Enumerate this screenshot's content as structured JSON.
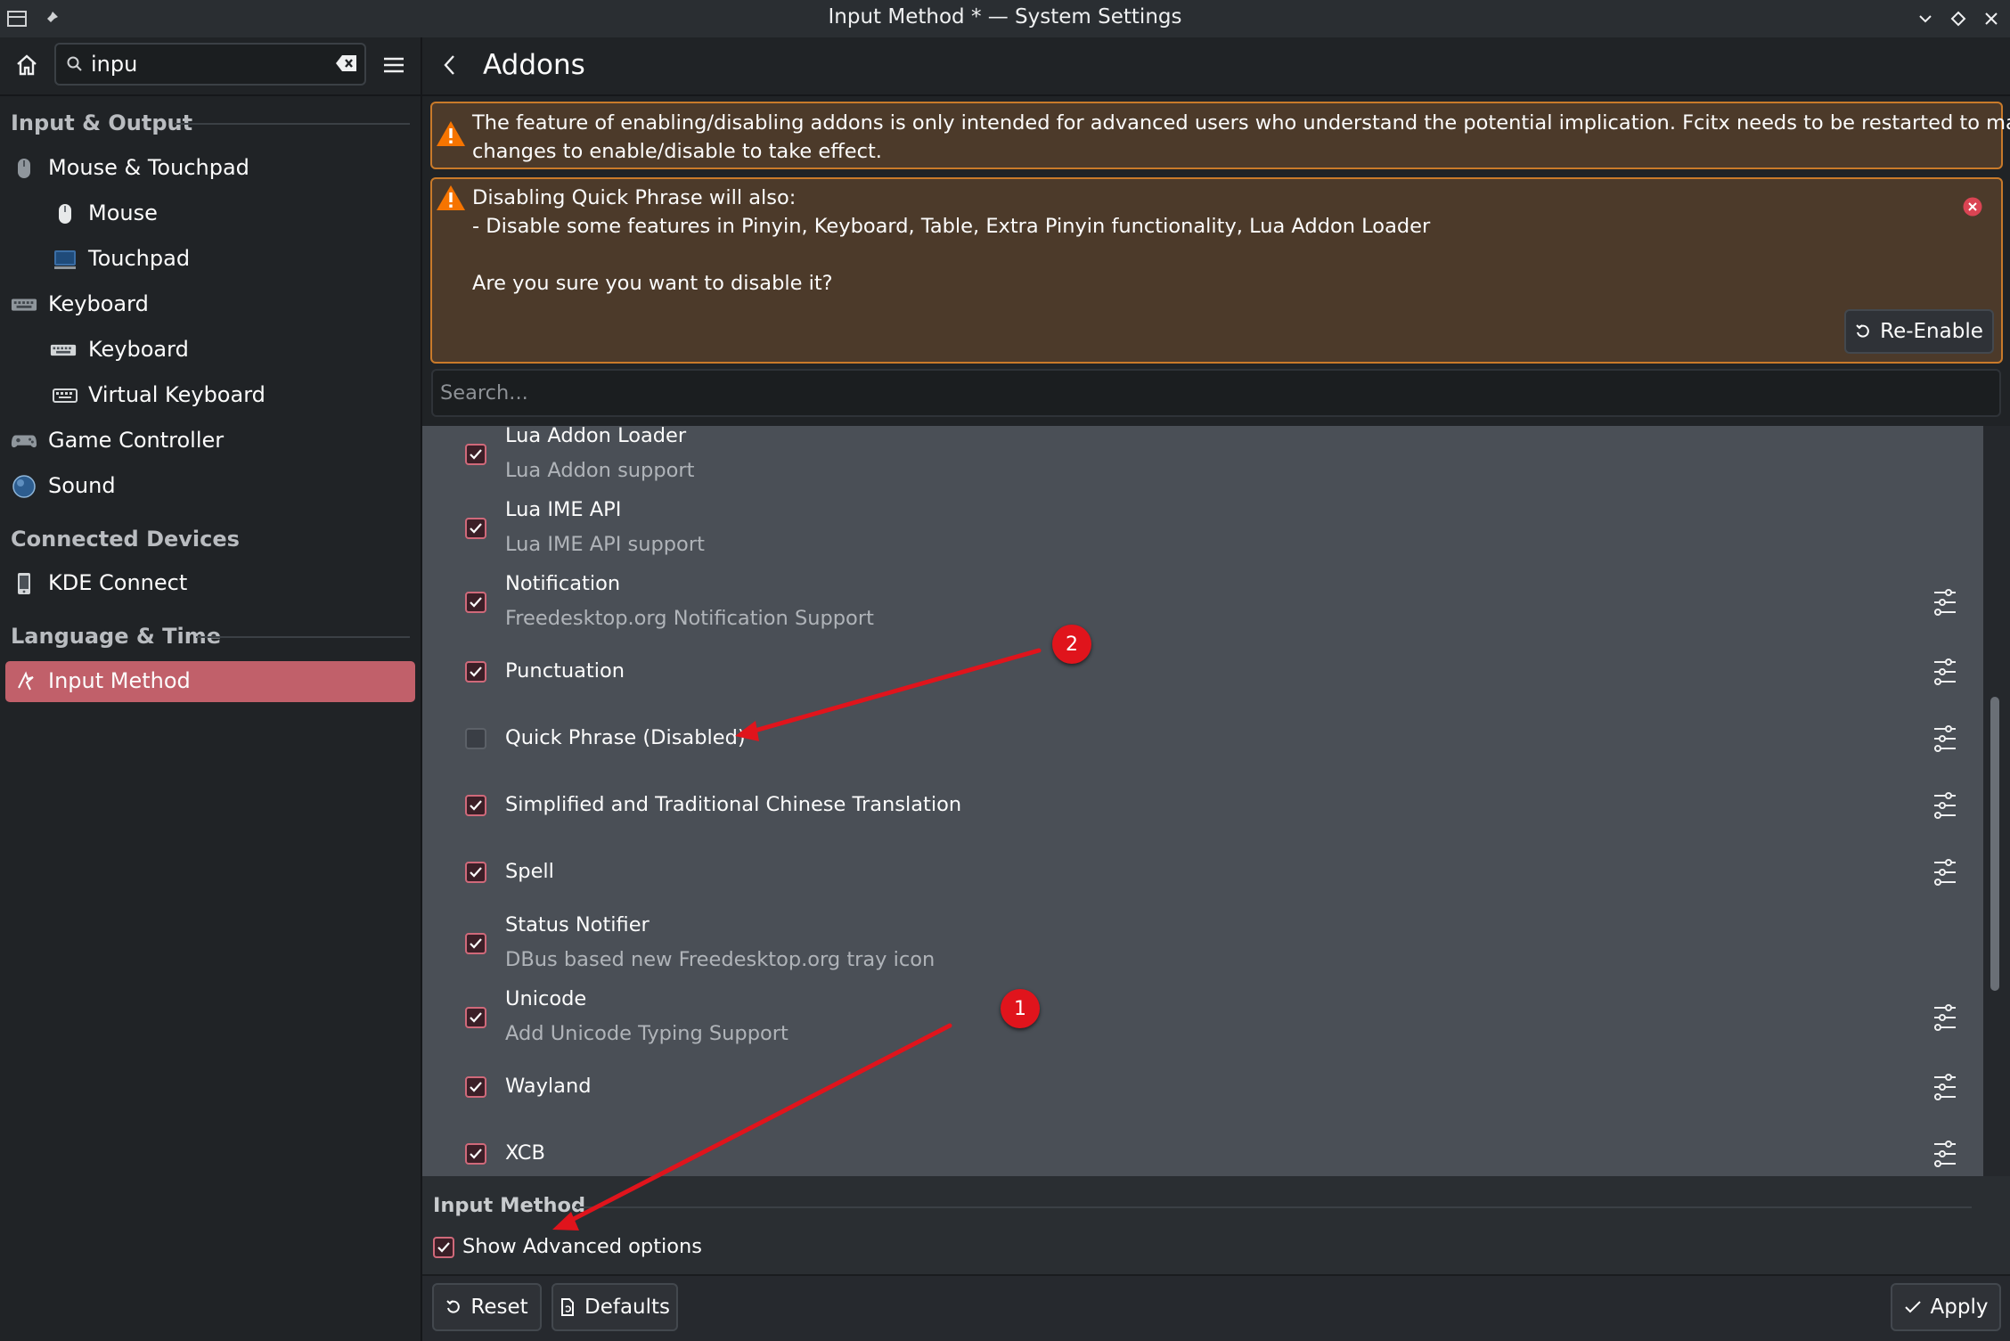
{
  "window": {
    "title": "Input Method * — System Settings"
  },
  "sidebar": {
    "search_value": "inpu",
    "categories": [
      {
        "title": "Input & Output",
        "items": [
          {
            "label": "Mouse & Touchpad",
            "icon": "mouse-icon"
          },
          {
            "label": "Mouse",
            "icon": "mouse-icon",
            "sub": true
          },
          {
            "label": "Touchpad",
            "icon": "touchpad-icon",
            "sub": true
          },
          {
            "label": "Keyboard",
            "icon": "keyboard-icon"
          },
          {
            "label": "Keyboard",
            "icon": "keyboard-icon",
            "sub": true
          },
          {
            "label": "Virtual Keyboard",
            "icon": "virtual-keyboard-icon",
            "sub": true
          },
          {
            "label": "Game Controller",
            "icon": "gamepad-icon"
          },
          {
            "label": "Sound",
            "icon": "sound-icon"
          }
        ]
      },
      {
        "title": "Connected Devices",
        "items": [
          {
            "label": "KDE Connect",
            "icon": "phone-icon"
          }
        ]
      },
      {
        "title": "Language & Time",
        "items": [
          {
            "label": "Input Method",
            "icon": "input-method-icon",
            "selected": true
          }
        ]
      }
    ],
    "selected_color": "#c1606a"
  },
  "page": {
    "title": "Addons"
  },
  "warning1": {
    "line1": "The feature of enabling/disabling addons is only intended for advanced users who understand the potential implication. Fcitx needs to be restarted to make the",
    "line2": "changes to enable/disable to take effect."
  },
  "warning2": {
    "line1": "Disabling Quick Phrase will also:",
    "line2": "- Disable some features in Pinyin, Keyboard, Table, Extra Pinyin functionality, Lua Addon Loader",
    "line3": "Are you sure you want to disable it?",
    "button": "Re-Enable"
  },
  "search": {
    "placeholder": "Search..."
  },
  "addons": [
    {
      "title": "Lua Addon Loader",
      "subtitle": "Lua Addon support",
      "checked": true,
      "configurable": false
    },
    {
      "title": "Lua IME API",
      "subtitle": "Lua IME API support",
      "checked": true,
      "configurable": false
    },
    {
      "title": "Notification",
      "subtitle": "Freedesktop.org Notification Support",
      "checked": true,
      "configurable": true
    },
    {
      "title": "Punctuation",
      "subtitle": "",
      "checked": true,
      "configurable": true
    },
    {
      "title": "Quick Phrase (Disabled)",
      "subtitle": "",
      "checked": false,
      "configurable": true
    },
    {
      "title": "Simplified and Traditional Chinese Translation",
      "subtitle": "",
      "checked": true,
      "configurable": true
    },
    {
      "title": "Spell",
      "subtitle": "",
      "checked": true,
      "configurable": true
    },
    {
      "title": "Status Notifier",
      "subtitle": "DBus based new Freedesktop.org tray icon",
      "checked": true,
      "configurable": false
    },
    {
      "title": "Unicode",
      "subtitle": "Add Unicode Typing Support",
      "checked": true,
      "configurable": true
    },
    {
      "title": "Wayland",
      "subtitle": "",
      "checked": true,
      "configurable": true
    },
    {
      "title": "XCB",
      "subtitle": "",
      "checked": true,
      "configurable": true
    }
  ],
  "lower": {
    "section_title": "Input Method",
    "advanced_label": "Show Advanced options",
    "advanced_checked": true
  },
  "footer": {
    "reset": "Reset",
    "defaults": "Defaults",
    "apply": "Apply"
  },
  "annotations": [
    {
      "label": "1"
    },
    {
      "label": "2"
    }
  ],
  "colors": {
    "accent": "#d0697a",
    "warning_border": "#c97a2a",
    "annotation": "#e0141c"
  }
}
